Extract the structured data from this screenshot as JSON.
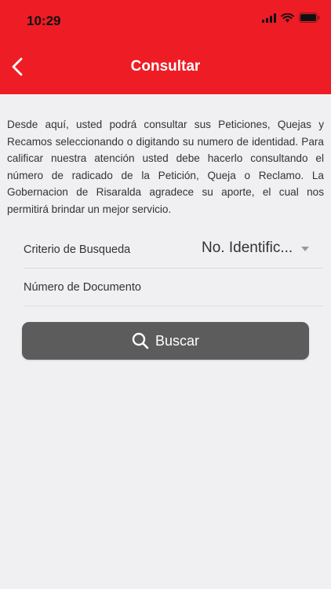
{
  "status_bar": {
    "time": "10:29",
    "icons": [
      "signal-icon",
      "wifi-icon",
      "battery-icon"
    ]
  },
  "header": {
    "title": "Consultar",
    "back_icon": "chevron-left-icon",
    "color": "#ee1c25"
  },
  "intro_text": "Desde aquí, usted podrá consultar sus Peticiones, Quejas y Recamos seleccionando o digitando su numero de identidad. Para calificar nuestra atención usted debe hacerlo consultando el número de radicado de la Petición, Queja o Reclamo. La Gobernacion de Risaralda agradece su aporte, el cual nos permitirá brindar un mejor servicio.",
  "form": {
    "criteria_label": "Criterio de Busqueda",
    "criteria_value": "No. Identific...",
    "document_placeholder": "Número de Documento",
    "document_value": ""
  },
  "search_button": {
    "label": "Buscar",
    "icon": "search-icon",
    "color": "#5c5c5c"
  }
}
